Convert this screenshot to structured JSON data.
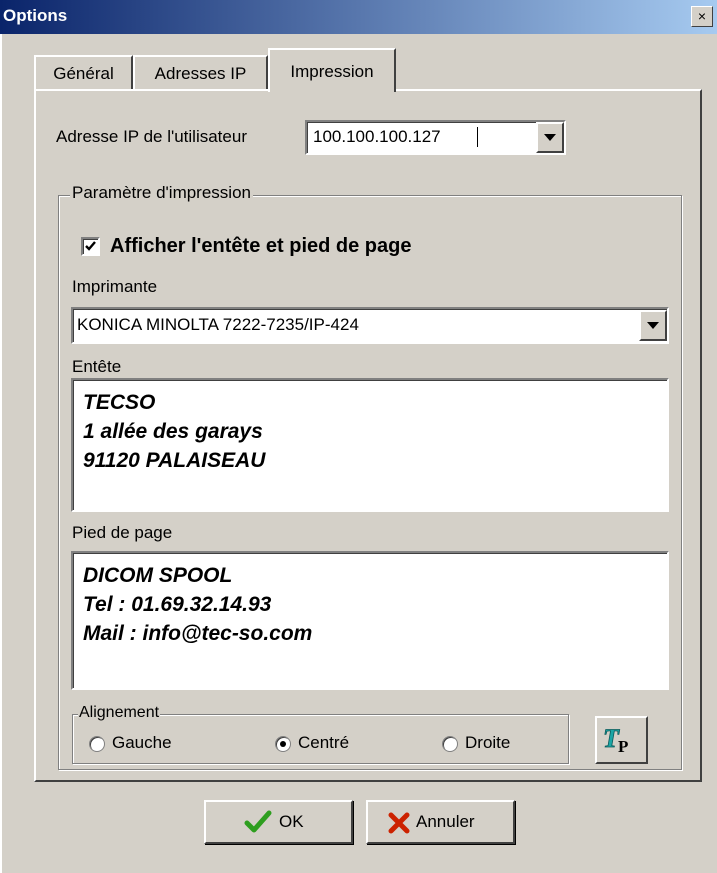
{
  "window": {
    "title": "Options",
    "close_glyph": "×"
  },
  "tabs": [
    {
      "label": "Général"
    },
    {
      "label": "Adresses IP"
    },
    {
      "label": "Impression"
    }
  ],
  "ip": {
    "label": "Adresse IP de l'utilisateur",
    "value": "100.100.100.127"
  },
  "print_group": {
    "caption": "Paramètre d'impression",
    "show_header_footer_label": "Afficher l'entête et pied de page",
    "show_header_footer_checked": true,
    "printer_label": "Imprimante",
    "printer_value": "KONICA MINOLTA 7222-7235/IP-424",
    "header_label": "Entête",
    "header_lines": [
      "TECSO",
      "1 allée des garays",
      "91120 PALAISEAU"
    ],
    "footer_label": "Pied de page",
    "footer_lines": [
      "DICOM SPOOL",
      "Tel : 01.69.32.14.93",
      "Mail : info@tec-so.com"
    ]
  },
  "alignment": {
    "caption": "Alignement",
    "options": [
      {
        "label": "Gauche",
        "selected": false
      },
      {
        "label": "Centré",
        "selected": true
      },
      {
        "label": "Droite",
        "selected": false
      }
    ]
  },
  "font_button": {
    "icon": "font-icon"
  },
  "buttons": {
    "ok_label": "OK",
    "cancel_label": "Annuler"
  },
  "colors": {
    "titlebar_start": "#0a246a",
    "titlebar_end": "#a6caf0",
    "ok_check": "#2e9e1f",
    "cancel_x": "#cc2200"
  }
}
